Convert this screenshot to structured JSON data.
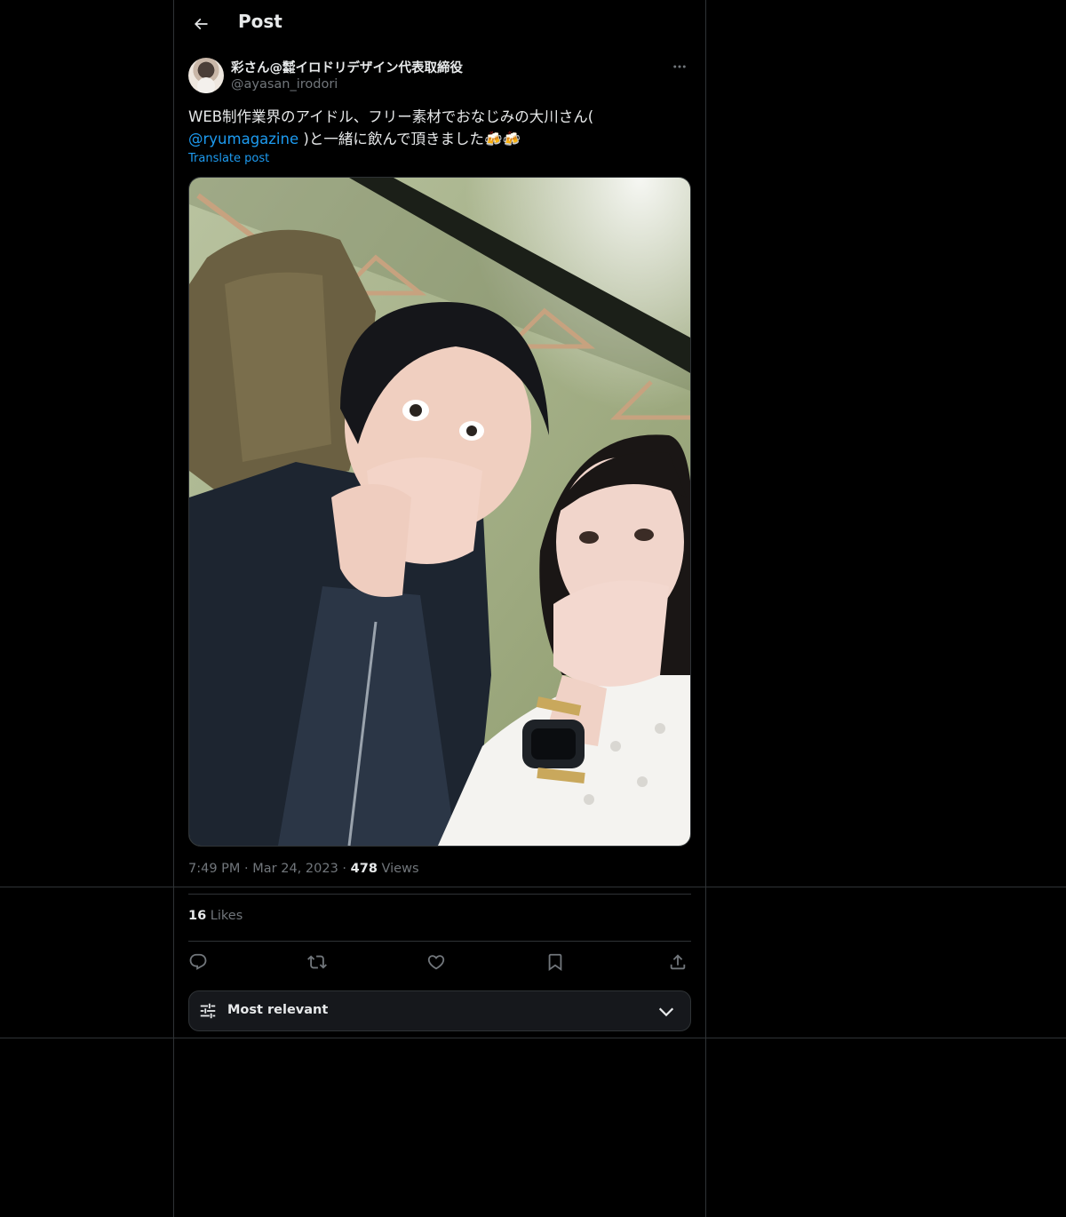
{
  "header": {
    "title": "Post"
  },
  "author": {
    "display_name": "彩さん@㍿イロドリデザイン代表取締役",
    "handle": "@ayasan_irodori"
  },
  "post": {
    "text_part1": "WEB制作業界のアイドル、フリー素材でおなじみの大川さん(",
    "mention": "@ryumagazine",
    "text_part2": ")と一緒に飲んで頂きました🍻🍻",
    "translate_label": "Translate post"
  },
  "meta": {
    "time": "7:49 PM",
    "date": "Mar 24, 2023",
    "dot": "·",
    "views_count": "478",
    "views_label": "Views"
  },
  "stats": {
    "likes_count": "16",
    "likes_label": "Likes"
  },
  "sort": {
    "label": "Most relevant"
  },
  "icons": {
    "back": "arrow-left-icon",
    "more": "more-horizontal-icon",
    "reply": "reply-icon",
    "repost": "repost-icon",
    "like": "heart-icon",
    "bookmark": "bookmark-icon",
    "share": "share-icon",
    "sort": "sliders-icon",
    "chevron": "chevron-down-icon"
  },
  "colors": {
    "accent": "#1d9bf0",
    "text": "#e7e9ea",
    "muted": "#71767b",
    "border": "#2f3336"
  }
}
